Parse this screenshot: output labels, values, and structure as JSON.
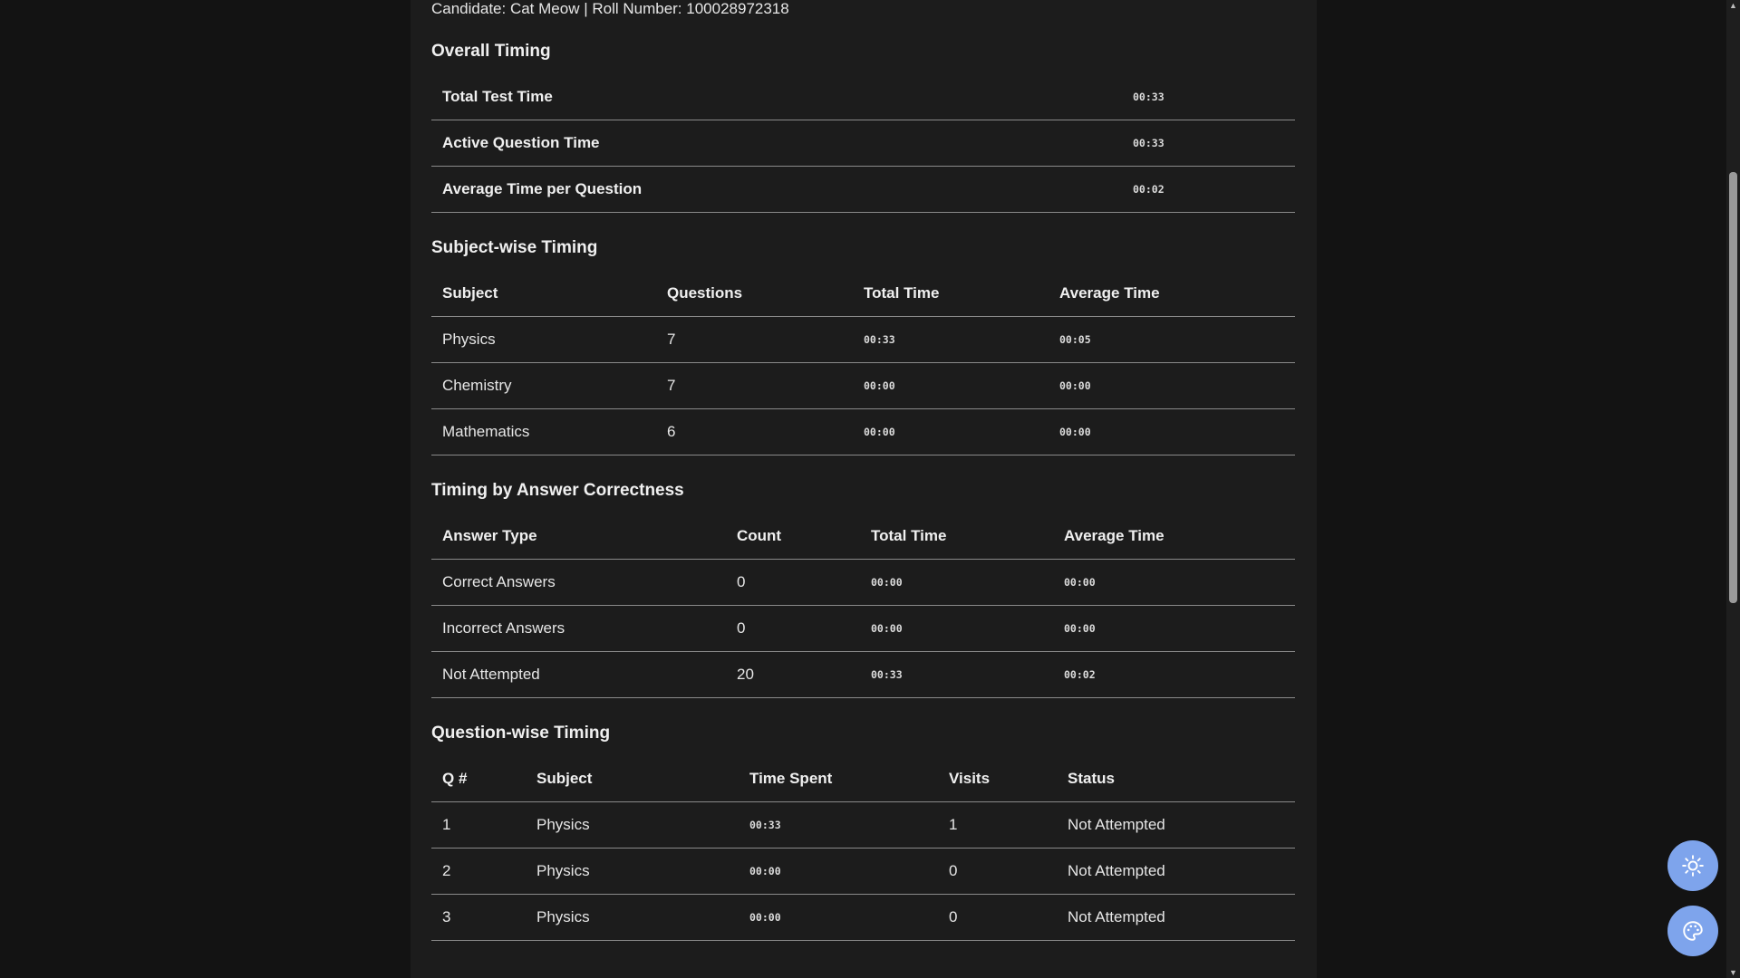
{
  "candidate_line": "Candidate: Cat Meow | Roll Number: 100028972318",
  "overall": {
    "title": "Overall Timing",
    "rows": [
      {
        "label": "Total Test Time",
        "value": "00:33"
      },
      {
        "label": "Active Question Time",
        "value": "00:33"
      },
      {
        "label": "Average Time per Question",
        "value": "00:02"
      }
    ]
  },
  "subject": {
    "title": "Subject-wise Timing",
    "headers": [
      "Subject",
      "Questions",
      "Total Time",
      "Average Time"
    ],
    "rows": [
      [
        "Physics",
        "7",
        "00:33",
        "00:05"
      ],
      [
        "Chemistry",
        "7",
        "00:00",
        "00:00"
      ],
      [
        "Mathematics",
        "6",
        "00:00",
        "00:00"
      ]
    ]
  },
  "correctness": {
    "title": "Timing by Answer Correctness",
    "headers": [
      "Answer Type",
      "Count",
      "Total Time",
      "Average Time"
    ],
    "rows": [
      [
        "Correct Answers",
        "0",
        "00:00",
        "00:00"
      ],
      [
        "Incorrect Answers",
        "0",
        "00:00",
        "00:00"
      ],
      [
        "Not Attempted",
        "20",
        "00:33",
        "00:02"
      ]
    ]
  },
  "questions": {
    "title": "Question-wise Timing",
    "headers": [
      "Q #",
      "Subject",
      "Time Spent",
      "Visits",
      "Status"
    ],
    "rows": [
      [
        "1",
        "Physics",
        "00:33",
        "1",
        "Not Attempted"
      ],
      [
        "2",
        "Physics",
        "00:00",
        "0",
        "Not Attempted"
      ],
      [
        "3",
        "Physics",
        "00:00",
        "0",
        "Not Attempted"
      ]
    ]
  },
  "fabs": [
    {
      "icon": "sun-icon"
    },
    {
      "icon": "palette-icon"
    }
  ],
  "colors": {
    "background": "#131313",
    "panel": "#1c1c1c",
    "accent": "#7ea4ec"
  }
}
